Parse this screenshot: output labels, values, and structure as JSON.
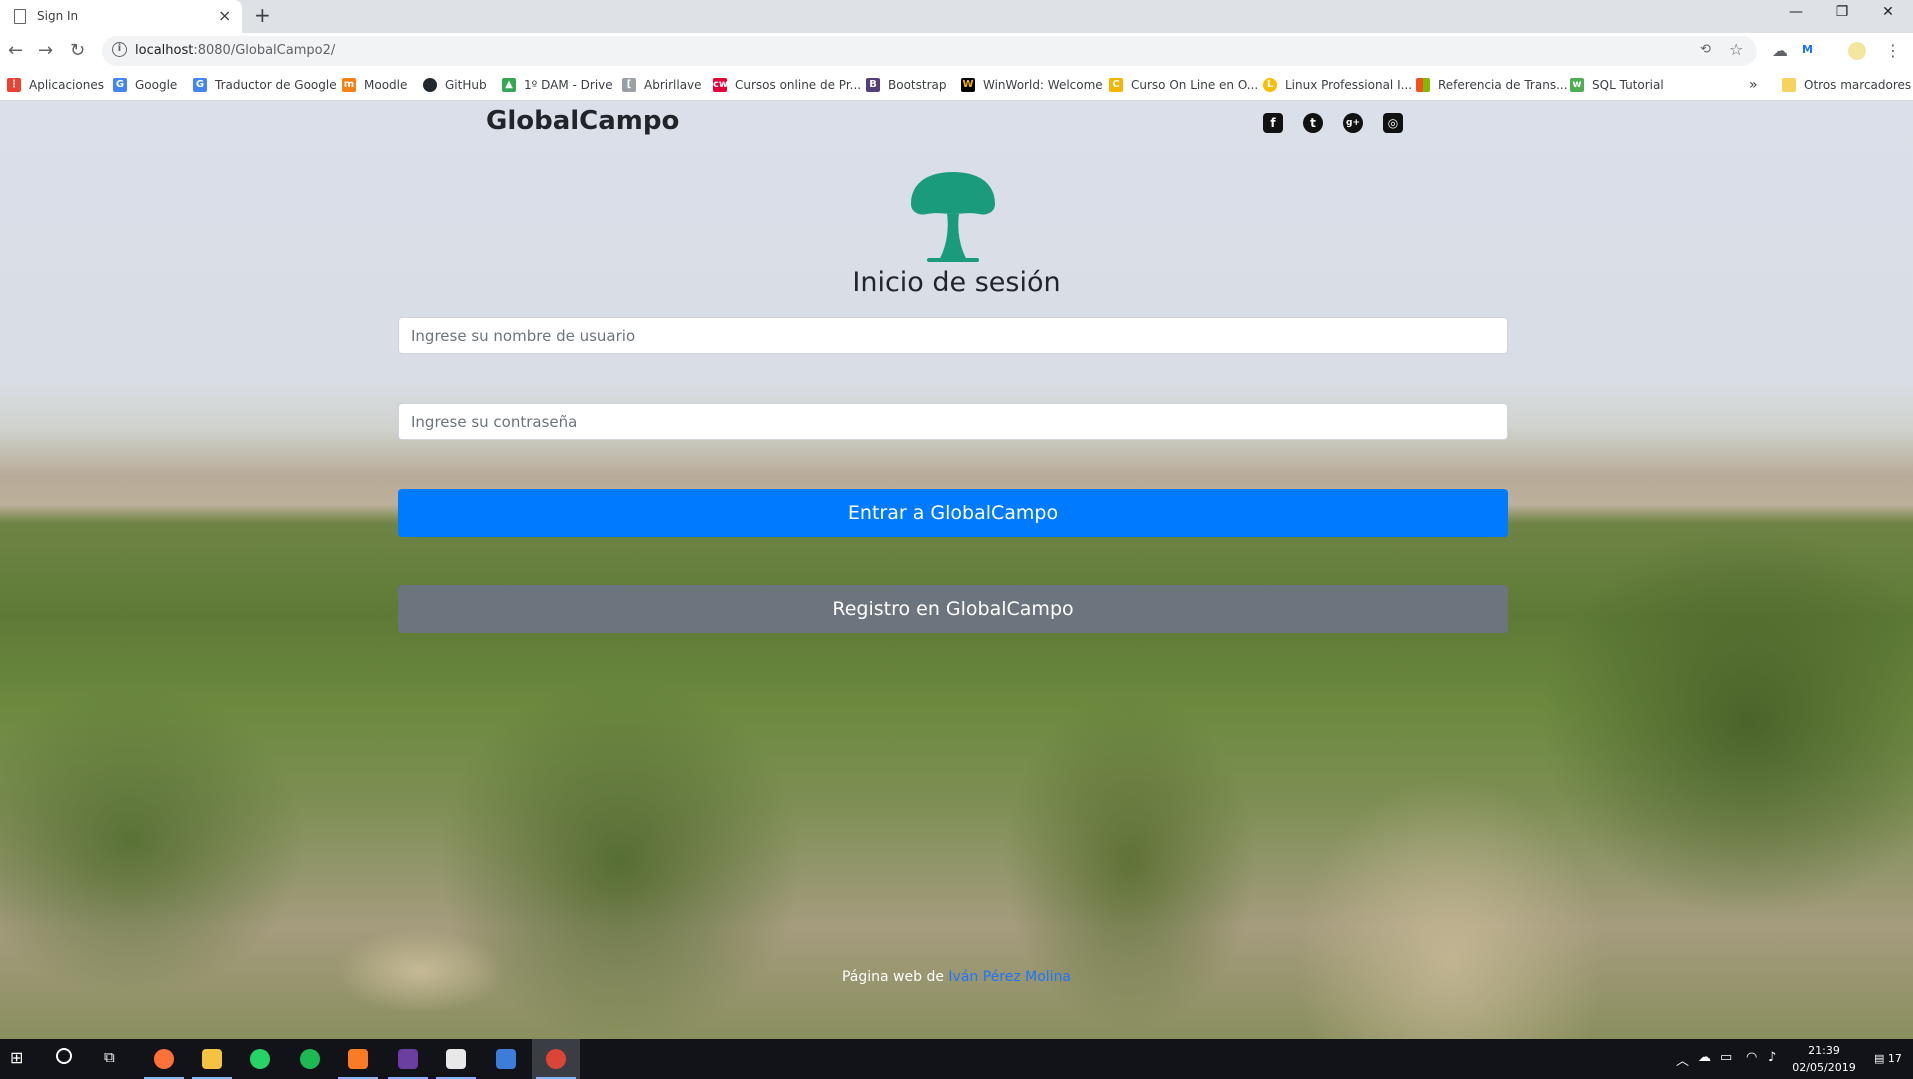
{
  "browser": {
    "tab_title": "Sign In",
    "tab_close": "×",
    "new_tab": "+",
    "window_minimize": "—",
    "window_restore": "❐",
    "window_close": "✕",
    "url_host": "localhost",
    "url_path": ":8080/GlobalCampo2/",
    "bookmarks": [
      {
        "label": "Aplicaciones",
        "icon": "apps-grid-icon",
        "color": "#ea4335"
      },
      {
        "label": "Google",
        "icon": "google-icon",
        "color": "#4285f4"
      },
      {
        "label": "Traductor de Google",
        "icon": "translate-icon",
        "color": "#4285f4"
      },
      {
        "label": "Moodle",
        "icon": "moodle-icon",
        "color": "#f98012"
      },
      {
        "label": "GitHub",
        "icon": "github-icon",
        "color": "#24292e"
      },
      {
        "label": "1º DAM - Drive",
        "icon": "drive-icon",
        "color": "#34a853"
      },
      {
        "label": "Abrirllave",
        "icon": "abrirllave-icon",
        "color": "#9aa0a6"
      },
      {
        "label": "Cursos online de Pr...",
        "icon": "cursos-icon",
        "color": "#e4003b"
      },
      {
        "label": "Bootstrap",
        "icon": "bootstrap-icon",
        "color": "#563d7c"
      },
      {
        "label": "WinWorld: Welcome",
        "icon": "winworld-icon",
        "color": "#000000"
      },
      {
        "label": "Curso On Line en O...",
        "icon": "curso-online-icon",
        "color": "#f4b400"
      },
      {
        "label": "Linux Professional I...",
        "icon": "linux-icon",
        "color": "#fbbc05"
      },
      {
        "label": "Referencia de Trans...",
        "icon": "microsoft-icon",
        "color": "#f25022"
      },
      {
        "label": "SQL Tutorial",
        "icon": "w3schools-icon",
        "color": "#4caf50"
      }
    ],
    "bookmarks_more": "»",
    "other_bookmarks": "Otros marcadores"
  },
  "page": {
    "brand": "GlobalCampo",
    "social": [
      {
        "icon": "facebook-icon",
        "glyph": "f"
      },
      {
        "icon": "twitter-icon",
        "glyph": "t"
      },
      {
        "icon": "google-plus-icon",
        "glyph": "g+"
      },
      {
        "icon": "instagram-icon",
        "glyph": "◎"
      }
    ],
    "heading": "Inicio de sesión",
    "username_placeholder": "Ingrese su nombre de usuario",
    "password_placeholder": "Ingrese su contraseña",
    "login_button": "Entrar a GlobalCampo",
    "register_button": "Registro en GlobalCampo",
    "footer_text": "Página web de ",
    "footer_link": "Iván Pérez Molina",
    "logo_color": "#1a9b7b",
    "primary_color": "#007bff",
    "secondary_color": "#6c757d"
  },
  "taskbar": {
    "time": "21:39",
    "date": "02/05/2019",
    "notifications": "17",
    "apps": [
      {
        "icon": "firefox-icon",
        "color": "#ff7139"
      },
      {
        "icon": "file-explorer-icon",
        "color": "#f5c242"
      },
      {
        "icon": "whatsapp-icon",
        "color": "#25d366"
      },
      {
        "icon": "spotify-icon",
        "color": "#1db954"
      },
      {
        "icon": "xampp-icon",
        "color": "#fb7a24"
      },
      {
        "icon": "game-icon",
        "color": "#6b3fa0"
      },
      {
        "icon": "dev-tool-icon",
        "color": "#e8e8e8"
      },
      {
        "icon": "virtualbox-icon",
        "color": "#3c7dd9"
      },
      {
        "icon": "chrome-icon",
        "color": "#db4437"
      }
    ]
  }
}
